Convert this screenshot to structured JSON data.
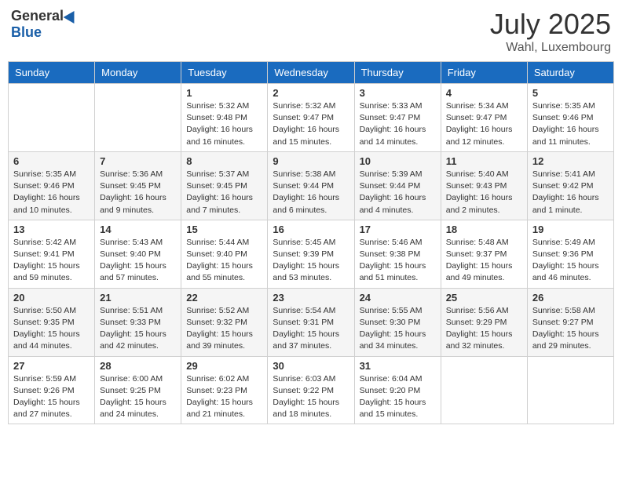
{
  "logo": {
    "general": "General",
    "blue": "Blue"
  },
  "title": "July 2025",
  "subtitle": "Wahl, Luxembourg",
  "days_of_week": [
    "Sunday",
    "Monday",
    "Tuesday",
    "Wednesday",
    "Thursday",
    "Friday",
    "Saturday"
  ],
  "weeks": [
    [
      {
        "day": "",
        "info": ""
      },
      {
        "day": "",
        "info": ""
      },
      {
        "day": "1",
        "info": "Sunrise: 5:32 AM\nSunset: 9:48 PM\nDaylight: 16 hours and 16 minutes."
      },
      {
        "day": "2",
        "info": "Sunrise: 5:32 AM\nSunset: 9:47 PM\nDaylight: 16 hours and 15 minutes."
      },
      {
        "day": "3",
        "info": "Sunrise: 5:33 AM\nSunset: 9:47 PM\nDaylight: 16 hours and 14 minutes."
      },
      {
        "day": "4",
        "info": "Sunrise: 5:34 AM\nSunset: 9:47 PM\nDaylight: 16 hours and 12 minutes."
      },
      {
        "day": "5",
        "info": "Sunrise: 5:35 AM\nSunset: 9:46 PM\nDaylight: 16 hours and 11 minutes."
      }
    ],
    [
      {
        "day": "6",
        "info": "Sunrise: 5:35 AM\nSunset: 9:46 PM\nDaylight: 16 hours and 10 minutes."
      },
      {
        "day": "7",
        "info": "Sunrise: 5:36 AM\nSunset: 9:45 PM\nDaylight: 16 hours and 9 minutes."
      },
      {
        "day": "8",
        "info": "Sunrise: 5:37 AM\nSunset: 9:45 PM\nDaylight: 16 hours and 7 minutes."
      },
      {
        "day": "9",
        "info": "Sunrise: 5:38 AM\nSunset: 9:44 PM\nDaylight: 16 hours and 6 minutes."
      },
      {
        "day": "10",
        "info": "Sunrise: 5:39 AM\nSunset: 9:44 PM\nDaylight: 16 hours and 4 minutes."
      },
      {
        "day": "11",
        "info": "Sunrise: 5:40 AM\nSunset: 9:43 PM\nDaylight: 16 hours and 2 minutes."
      },
      {
        "day": "12",
        "info": "Sunrise: 5:41 AM\nSunset: 9:42 PM\nDaylight: 16 hours and 1 minute."
      }
    ],
    [
      {
        "day": "13",
        "info": "Sunrise: 5:42 AM\nSunset: 9:41 PM\nDaylight: 15 hours and 59 minutes."
      },
      {
        "day": "14",
        "info": "Sunrise: 5:43 AM\nSunset: 9:40 PM\nDaylight: 15 hours and 57 minutes."
      },
      {
        "day": "15",
        "info": "Sunrise: 5:44 AM\nSunset: 9:40 PM\nDaylight: 15 hours and 55 minutes."
      },
      {
        "day": "16",
        "info": "Sunrise: 5:45 AM\nSunset: 9:39 PM\nDaylight: 15 hours and 53 minutes."
      },
      {
        "day": "17",
        "info": "Sunrise: 5:46 AM\nSunset: 9:38 PM\nDaylight: 15 hours and 51 minutes."
      },
      {
        "day": "18",
        "info": "Sunrise: 5:48 AM\nSunset: 9:37 PM\nDaylight: 15 hours and 49 minutes."
      },
      {
        "day": "19",
        "info": "Sunrise: 5:49 AM\nSunset: 9:36 PM\nDaylight: 15 hours and 46 minutes."
      }
    ],
    [
      {
        "day": "20",
        "info": "Sunrise: 5:50 AM\nSunset: 9:35 PM\nDaylight: 15 hours and 44 minutes."
      },
      {
        "day": "21",
        "info": "Sunrise: 5:51 AM\nSunset: 9:33 PM\nDaylight: 15 hours and 42 minutes."
      },
      {
        "day": "22",
        "info": "Sunrise: 5:52 AM\nSunset: 9:32 PM\nDaylight: 15 hours and 39 minutes."
      },
      {
        "day": "23",
        "info": "Sunrise: 5:54 AM\nSunset: 9:31 PM\nDaylight: 15 hours and 37 minutes."
      },
      {
        "day": "24",
        "info": "Sunrise: 5:55 AM\nSunset: 9:30 PM\nDaylight: 15 hours and 34 minutes."
      },
      {
        "day": "25",
        "info": "Sunrise: 5:56 AM\nSunset: 9:29 PM\nDaylight: 15 hours and 32 minutes."
      },
      {
        "day": "26",
        "info": "Sunrise: 5:58 AM\nSunset: 9:27 PM\nDaylight: 15 hours and 29 minutes."
      }
    ],
    [
      {
        "day": "27",
        "info": "Sunrise: 5:59 AM\nSunset: 9:26 PM\nDaylight: 15 hours and 27 minutes."
      },
      {
        "day": "28",
        "info": "Sunrise: 6:00 AM\nSunset: 9:25 PM\nDaylight: 15 hours and 24 minutes."
      },
      {
        "day": "29",
        "info": "Sunrise: 6:02 AM\nSunset: 9:23 PM\nDaylight: 15 hours and 21 minutes."
      },
      {
        "day": "30",
        "info": "Sunrise: 6:03 AM\nSunset: 9:22 PM\nDaylight: 15 hours and 18 minutes."
      },
      {
        "day": "31",
        "info": "Sunrise: 6:04 AM\nSunset: 9:20 PM\nDaylight: 15 hours and 15 minutes."
      },
      {
        "day": "",
        "info": ""
      },
      {
        "day": "",
        "info": ""
      }
    ]
  ]
}
